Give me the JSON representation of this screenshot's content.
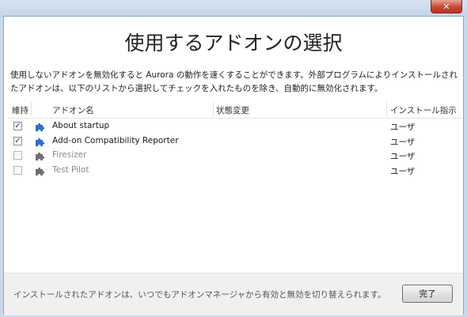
{
  "window": {
    "close_glyph": "✕"
  },
  "heading": "使用するアドオンの選択",
  "description": "使用しないアドオンを無効化すると Aurora の動作を速くすることができます。外部プログラムによりインストールされたアドオンは、以下のリストから選択してチェックを入れたものを除き、自動的に無効化されます。",
  "table": {
    "columns": {
      "keep": "維持",
      "name": "アドオン名",
      "status": "状態変更",
      "install": "インストール指示"
    },
    "rows": [
      {
        "name": "About startup",
        "checked": true,
        "enabled": true,
        "status": "",
        "install": "ユーザ"
      },
      {
        "name": "Add-on Compatibility Reporter",
        "checked": true,
        "enabled": true,
        "status": "",
        "install": "ユーザ"
      },
      {
        "name": "Firesizer",
        "checked": false,
        "enabled": false,
        "status": "",
        "install": "ユーザ"
      },
      {
        "name": "Test Pilot",
        "checked": false,
        "enabled": false,
        "status": "",
        "install": "ユーザ"
      }
    ]
  },
  "footer": {
    "note": "インストールされたアドオンは、いつでもアドオンマネージャから有効と無効を切り替えられます。",
    "done_label": "完了"
  },
  "colors": {
    "puzzle_active": "#2f6fcb",
    "puzzle_inactive": "#6e6e6e"
  }
}
